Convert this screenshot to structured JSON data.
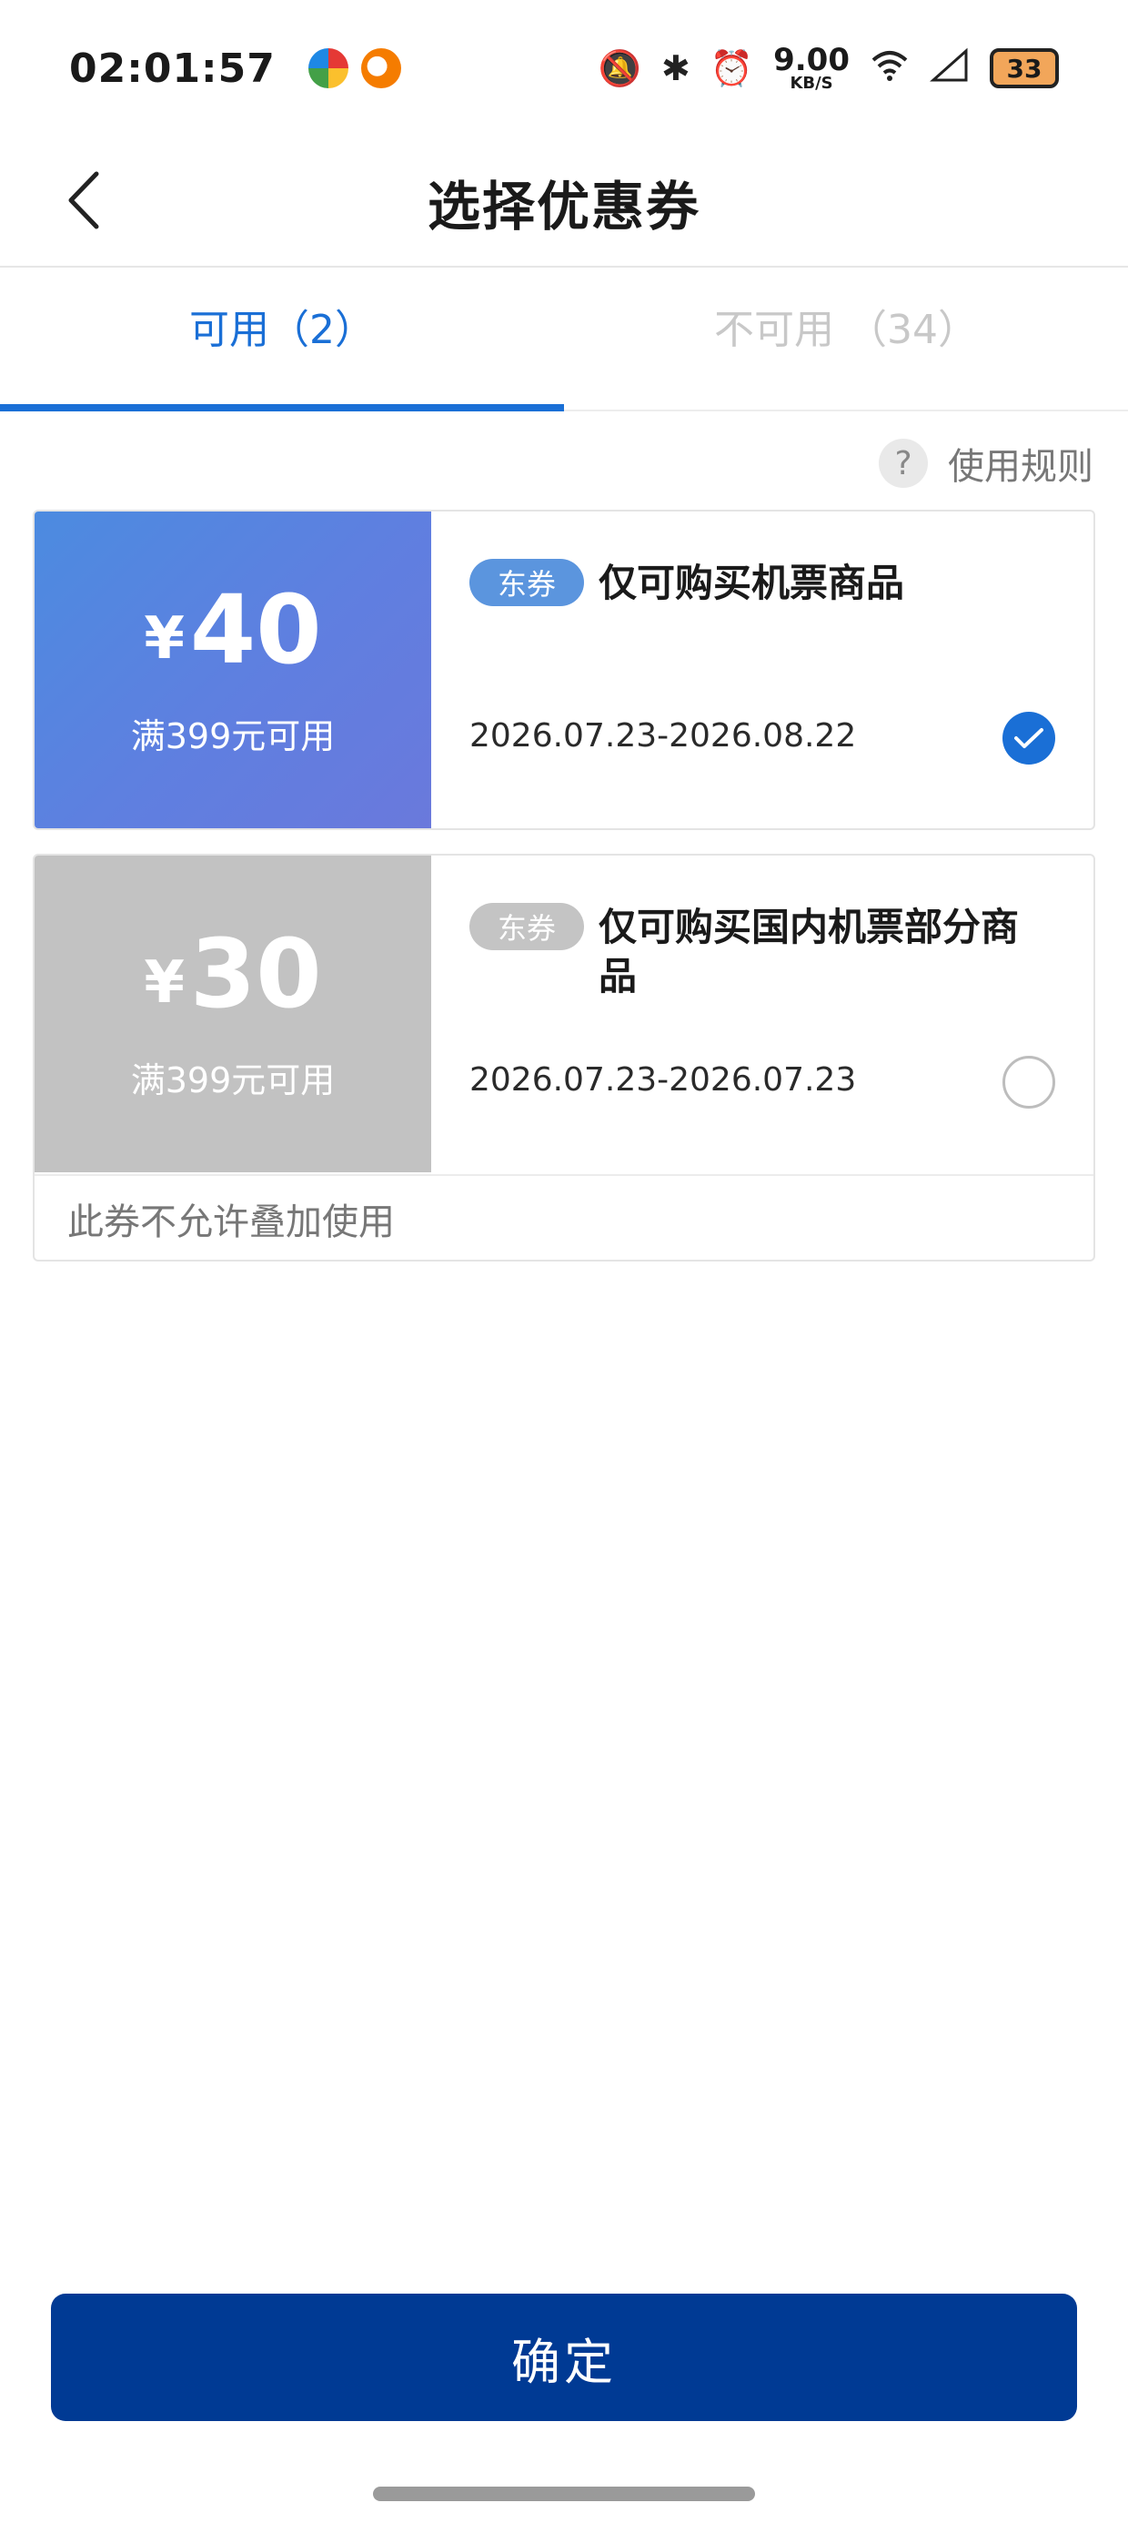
{
  "status": {
    "time": "02:01:57",
    "speed_value": "9.00",
    "speed_unit": "KB/S",
    "battery": "33"
  },
  "nav": {
    "title": "选择优惠券"
  },
  "tabs": [
    {
      "label": "可用（2）",
      "active": true
    },
    {
      "label": "不可用 （34）",
      "active": false
    }
  ],
  "rules": {
    "icon": "?",
    "label": "使用规则"
  },
  "coupons": [
    {
      "currency": "¥",
      "amount": "40",
      "condition": "满399元可用",
      "tag": "东券",
      "title": "仅可购买机票商品",
      "date_range": "2026.07.23-2026.08.22",
      "selected": true
    },
    {
      "currency": "¥",
      "amount": "30",
      "condition": "满399元可用",
      "tag": "东券",
      "title": "仅可购买国内机票部分商品",
      "date_range": "2026.07.23-2026.07.23",
      "selected": false,
      "note": "此券不允许叠加使用"
    }
  ],
  "confirm_label": "确定",
  "colors": {
    "accent": "#1a6fd6",
    "confirm_bg": "#003a94",
    "coupon_active": "#5f7fe0",
    "coupon_inactive": "#c2c2c2"
  }
}
